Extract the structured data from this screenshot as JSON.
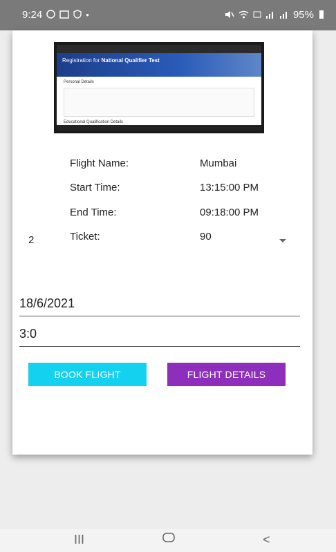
{
  "statusbar": {
    "time": "9:24",
    "battery": "95%",
    "left_icons": [
      "whatsapp-icon",
      "gallery-icon",
      "shield-icon",
      "dot-icon"
    ],
    "right_icons": [
      "mute-icon",
      "wifi-icon",
      "volte-icon",
      "signal-icon",
      "signal-icon",
      "battery-icon"
    ]
  },
  "thumbnail": {
    "banner_prefix": "Registration for",
    "banner_bold": "National Qualifier Test",
    "section1": "Personal Details",
    "section2": "Educational Qualification Details"
  },
  "flight_info": {
    "name_label": "Flight Name:",
    "name_value": "Mumbai",
    "start_label": "Start Time:",
    "start_value": "13:15:00 PM",
    "end_label": "End Time:",
    "end_value": "09:18:00 PM",
    "ticket_label": "Ticket:",
    "ticket_value": "90"
  },
  "form": {
    "spinner_value": "2",
    "date_value": "18/6/2021",
    "time_value": "3:0"
  },
  "buttons": {
    "book_label": "BOOK FLIGHT",
    "details_label": "FLIGHT DETAILS"
  },
  "navbar": {
    "recents": "III",
    "home": "○",
    "back": "<"
  },
  "colors": {
    "book_button": "#14d2ef",
    "details_button": "#8e2fbc",
    "statusbar": "#7a7a7a"
  }
}
